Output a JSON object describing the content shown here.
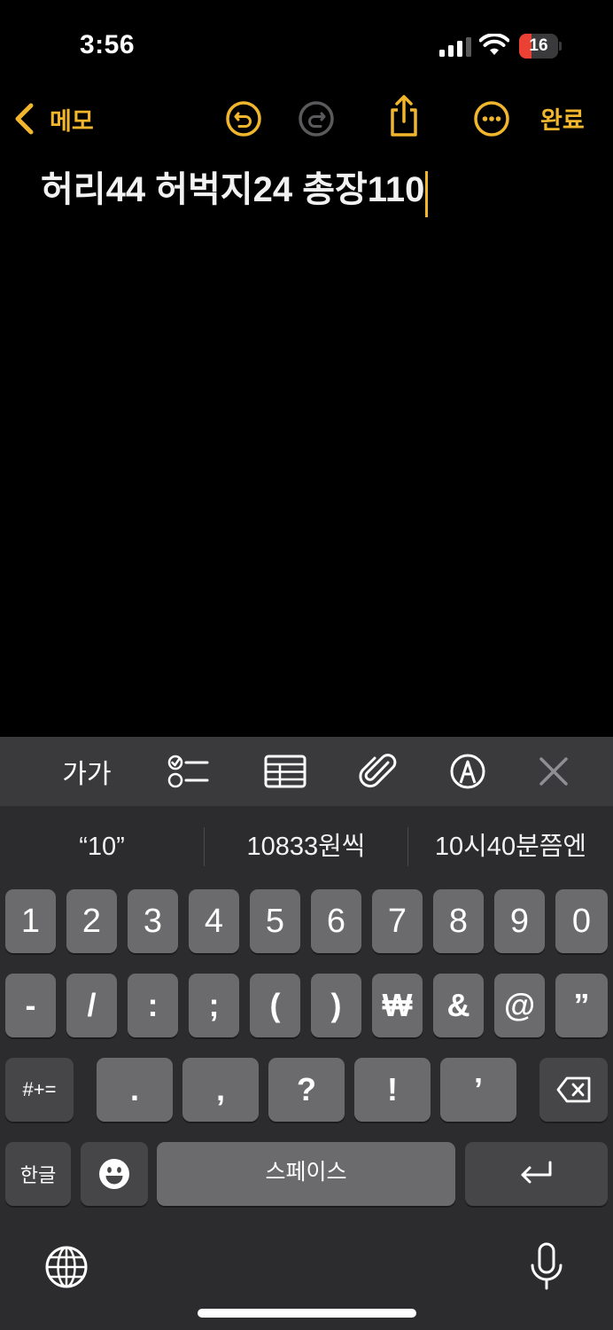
{
  "status": {
    "time": "3:56",
    "battery_level": "16",
    "battery_percent": 16
  },
  "nav": {
    "back_label": "메모",
    "done_label": "완료",
    "accent_color": "#f2b62d"
  },
  "note": {
    "text": "허리44 허벅지24 총장110"
  },
  "toolbar": {
    "text_format_label": "가가"
  },
  "suggestions": [
    "“10”",
    "10833원씩",
    "10시40분쯤엔"
  ],
  "keyboard": {
    "row1": [
      "1",
      "2",
      "3",
      "4",
      "5",
      "6",
      "7",
      "8",
      "9",
      "0"
    ],
    "row2": [
      "-",
      "/",
      ":",
      ";",
      "(",
      ")",
      "₩",
      "&",
      "@",
      "”"
    ],
    "row3_symbols": [
      ".",
      ",",
      "?",
      "!",
      "’"
    ],
    "more_symbols_label": "#+=",
    "language_label": "한글",
    "space_label": "스페이스"
  }
}
